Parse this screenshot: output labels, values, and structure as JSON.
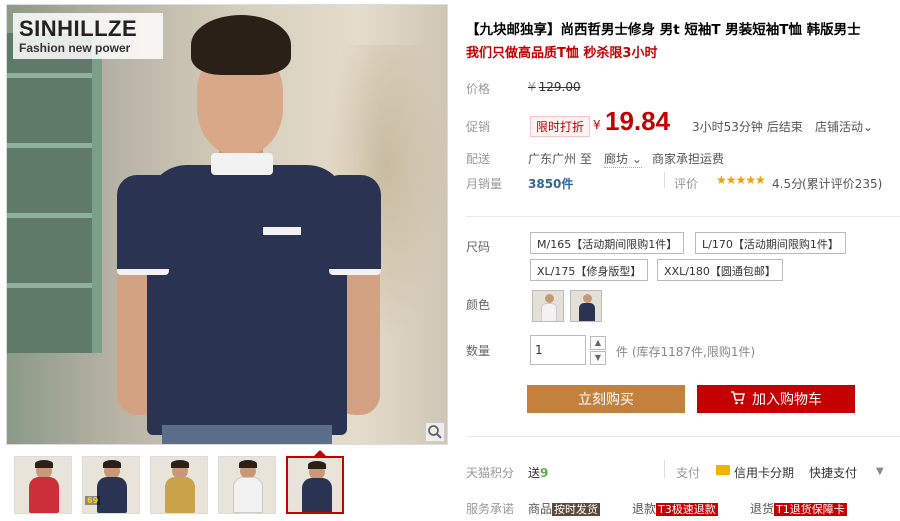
{
  "brand": {
    "name": "SINHILLZE",
    "tagline": "Fashion new power"
  },
  "thumbnails": [
    {
      "shirt_color": "#cc2e3a",
      "badge": ""
    },
    {
      "shirt_color": "#2a3352",
      "badge": "69"
    },
    {
      "shirt_color": "#c9a24a",
      "badge": ""
    },
    {
      "shirt_color": "#f2f2f2",
      "badge": ""
    },
    {
      "shirt_color": "#2a3352",
      "badge": ""
    }
  ],
  "product": {
    "title": "【九块邮独享】尚西哲男士修身 男t 短袖T 男装短袖T恤 韩版男士",
    "subtitle": "我们只做高品质T恤 秒杀限3小时"
  },
  "price": {
    "label": "价格",
    "yen": "¥",
    "original": "129.00",
    "promo_label": "促销",
    "promo_tag": "限时打折",
    "sale_yen": "¥",
    "sale": "19.84",
    "countdown": "3小时53分钟 后结束",
    "activity": "店铺活动⌄"
  },
  "shipping": {
    "label": "配送",
    "from": "广东广州 至",
    "to": "廊坊 ⌄",
    "fee": "商家承担运费"
  },
  "sales": {
    "label": "月销量",
    "value": "3850件",
    "review_label": "评价",
    "stars": "★★★★★",
    "rating": "4.5分",
    "review_count": "(累计评价235)"
  },
  "sizes": {
    "label": "尺码",
    "options": [
      "M/165【活动期间限购1件】",
      "L/170【活动期间限购1件】",
      "XL/175【修身版型】",
      "XXL/180【圆通包邮】"
    ]
  },
  "colors": {
    "label": "颜色",
    "options": [
      "#f2f2f2",
      "#2a3352"
    ]
  },
  "quantity": {
    "label": "数量",
    "value": "1",
    "up": "▲",
    "down": "▼",
    "stock": "件 (库存1187件,限购1件)"
  },
  "actions": {
    "buy_now": "立刻购买",
    "add_cart": "加入购物车"
  },
  "points": {
    "label": "天猫积分",
    "prefix": "送",
    "value": "9"
  },
  "payment": {
    "label": "支付",
    "card": "信用卡分期",
    "quick": "快捷支付",
    "more": "▼"
  },
  "service": {
    "label": "服务承诺",
    "items": [
      {
        "prefix": "商品",
        "tag": "按时发货",
        "tag_style": "dark"
      },
      {
        "prefix": "退款",
        "tag": "T3极速退款",
        "tag_style": "red"
      },
      {
        "prefix": "退货",
        "tag": "T1退货保障卡",
        "tag_style": "red"
      }
    ]
  },
  "colors_theme": {
    "accent": "#c40000",
    "buy": "#c4803d",
    "link": "#336699"
  }
}
